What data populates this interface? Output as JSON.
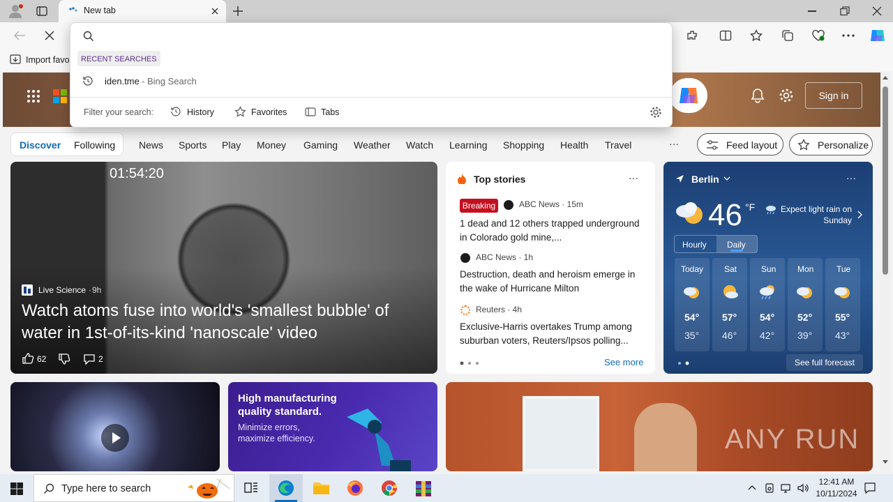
{
  "browser": {
    "tab_title": "New tab",
    "favorites_bar": {
      "import_label": "Import favo"
    }
  },
  "omnibox": {
    "recent_heading": "RECENT SEARCHES",
    "recent_item": {
      "query": "iden.tme",
      "suffix": " - Bing Search"
    },
    "filter_label": "Filter your search:",
    "filters": [
      {
        "label": "History",
        "icon": "clock-icon"
      },
      {
        "label": "Favorites",
        "icon": "star-icon"
      },
      {
        "label": "Tabs",
        "icon": "tabs-icon"
      }
    ]
  },
  "header": {
    "sign_in": "Sign in"
  },
  "nav": {
    "discover": "Discover",
    "following": "Following",
    "items": [
      "News",
      "Sports",
      "Play",
      "Money",
      "Gaming",
      "Weather",
      "Watch",
      "Learning",
      "Shopping",
      "Health",
      "Travel"
    ],
    "more": "···",
    "feed_layout": "Feed layout",
    "personalize": "Personalize"
  },
  "hero_story": {
    "video_time": "01:54:20",
    "source": "Live Science",
    "age": "9h",
    "title": "Watch atoms fuse into world's 'smallest bubble' of water in 1st-of-its-kind 'nanoscale' video",
    "likes": "62",
    "comments": "2"
  },
  "top_stories": {
    "title": "Top stories",
    "more": "···",
    "items": [
      {
        "badge": "Breaking",
        "source": "ABC News · 15m",
        "title": "1 dead and 12 others trapped underground in Colorado gold mine,..."
      },
      {
        "source": "ABC News · 1h",
        "title": "Destruction, death and heroism emerge in the wake of Hurricane Milton"
      },
      {
        "source": "Reuters · 4h",
        "title": "Exclusive-Harris overtakes Trump among suburban voters, Reuters/Ipsos polling..."
      }
    ],
    "see_more": "See more"
  },
  "weather": {
    "location": "Berlin",
    "temp": "46",
    "unit": "°F",
    "note": "Expect light rain on Sunday",
    "tab_hourly": "Hourly",
    "tab_daily": "Daily",
    "days": [
      {
        "day": "Today",
        "hi": "54°",
        "lo": "35°",
        "icon": "partly-cloudy-icon"
      },
      {
        "day": "Sat",
        "hi": "57°",
        "lo": "46°",
        "icon": "partly-sunny-icon"
      },
      {
        "day": "Sun",
        "hi": "54°",
        "lo": "42°",
        "icon": "rain-icon"
      },
      {
        "day": "Mon",
        "hi": "52°",
        "lo": "39°",
        "icon": "partly-cloudy-icon"
      },
      {
        "day": "Tue",
        "hi": "55°",
        "lo": "43°",
        "icon": "partly-cloudy-icon"
      }
    ],
    "see_full": "See full forecast",
    "more": "···"
  },
  "ad": {
    "headline": "High manufacturing quality standard.",
    "body": "Minimize errors, maximize efficiency."
  },
  "watermark": "ANY RUN",
  "taskbar": {
    "search_placeholder": "Type here to search",
    "time": "12:41 AM",
    "date": "10/11/2024"
  },
  "colors": {
    "accent": "#0f6cbd",
    "breaking": "#c50f1f",
    "weather_bg": "#1c3f74"
  }
}
